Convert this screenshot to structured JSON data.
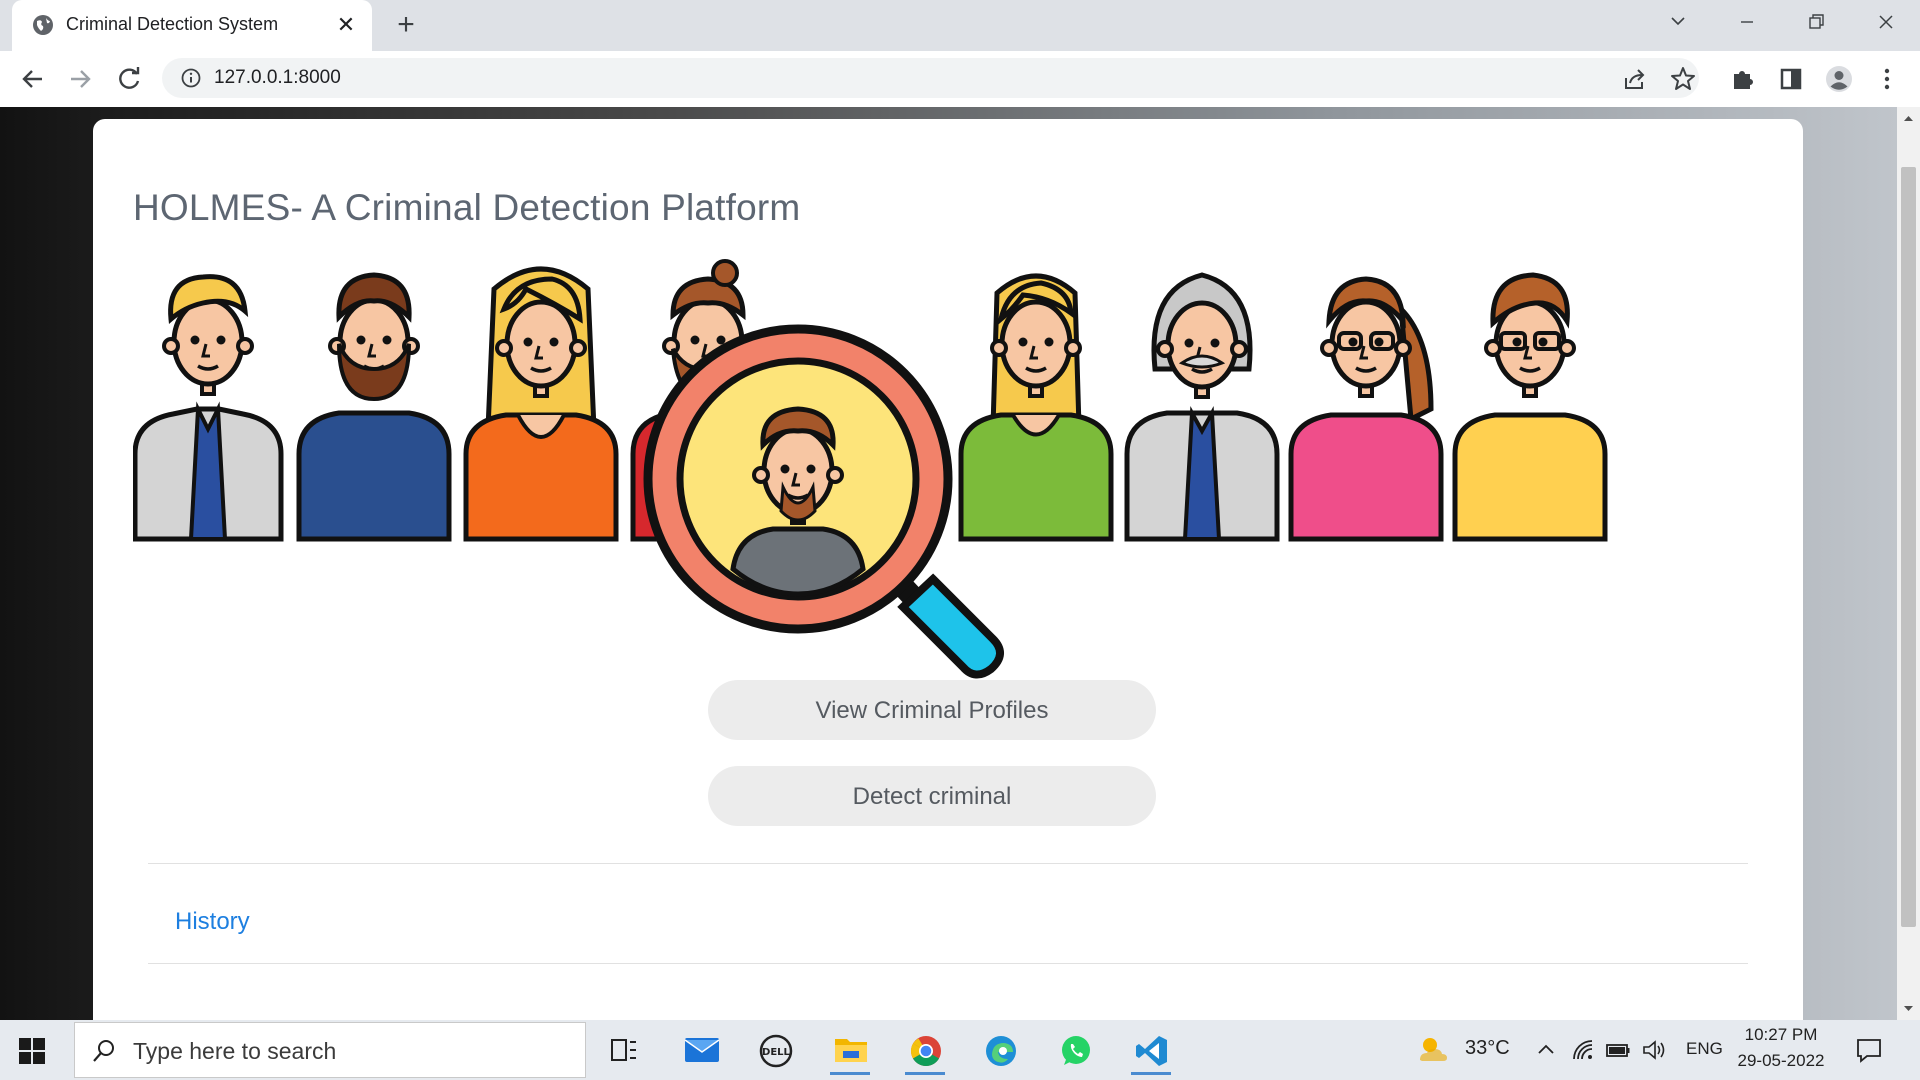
{
  "browser": {
    "tab_title": "Criminal Detection System",
    "tab_close": "✕",
    "new_tab": "+",
    "url": "127.0.0.1:8000"
  },
  "page": {
    "title": "HOLMES- A Criminal Detection Platform",
    "buttons": {
      "view_profiles": "View Criminal Profiles",
      "detect": "Detect criminal"
    },
    "history_link": "History",
    "hero_palette": {
      "lens_ring": "#f2826a",
      "lens_fill": "#fde47a",
      "handle": "#1ec3ea",
      "outline": "#111111"
    }
  },
  "taskbar": {
    "search_placeholder": "Type here to search",
    "weather": {
      "temperature": "33°C",
      "icon": "partly-sunny-icon"
    },
    "language": "ENG",
    "time": "10:27 PM",
    "date": "29-05-2022",
    "apps": [
      "task-view-icon",
      "mail-icon",
      "dell-icon",
      "file-explorer-icon",
      "chrome-icon",
      "edge-icon",
      "whatsapp-icon",
      "vscode-icon"
    ]
  }
}
